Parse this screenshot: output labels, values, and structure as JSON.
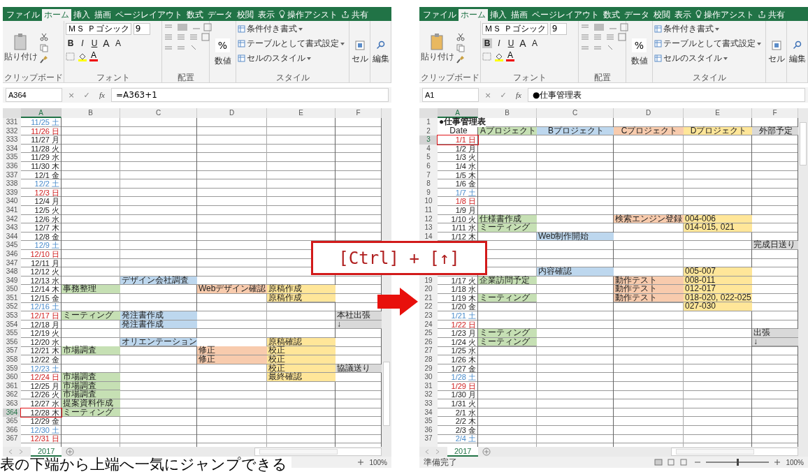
{
  "windows": [
    {
      "tabs": [
        {
          "label": "ファイル",
          "selected": false
        },
        {
          "label": "ホーム",
          "selected": true
        },
        {
          "label": "挿入",
          "selected": false
        },
        {
          "label": "描画",
          "selected": false
        },
        {
          "label": "ページレイアウト",
          "selected": false
        },
        {
          "label": "数式",
          "selected": false
        },
        {
          "label": "データ",
          "selected": false
        },
        {
          "label": "校閲",
          "selected": false
        },
        {
          "label": "表示",
          "selected": false
        }
      ],
      "tell_me": "操作アシスト",
      "share": "共有",
      "clipboard": {
        "paste": "貼り付け",
        "group": "クリップボード"
      },
      "font": {
        "name": "ＭＳ Ｐゴシック",
        "size": "9",
        "buttons": [
          {
            "label": "B",
            "selected": false
          },
          {
            "label": "I",
            "selected": false
          },
          {
            "label": "U",
            "selected": false
          }
        ],
        "grow": "A",
        "shrink": "A",
        "color_letter": "A",
        "group": "フォント"
      },
      "alignment": {
        "group": "配置"
      },
      "number": {
        "symbol": "%",
        "label": "数値"
      },
      "styles": {
        "items": [
          "条件付き書式",
          "テーブルとして書式設定",
          "セルのスタイル"
        ],
        "group": "スタイル"
      },
      "cells_label": "セル",
      "editing_label": "編集",
      "name_box": "A364",
      "formula_buttons": [
        "×",
        "✓",
        "fx"
      ],
      "formula": "=A363+1",
      "columns": [
        {
          "label": "A",
          "selected": true
        },
        {
          "label": "B",
          "selected": false
        },
        {
          "label": "C",
          "selected": false
        },
        {
          "label": "D",
          "selected": false
        },
        {
          "label": "E",
          "selected": false
        },
        {
          "label": "F",
          "selected": false
        }
      ],
      "rows": [
        {
          "kind": "sat",
          "num": "331",
          "date": "11/25 土",
          "selected": false
        },
        {
          "kind": "sun",
          "num": "332",
          "date": "11/26 日",
          "selected": false
        },
        {
          "kind": "weekday",
          "num": "333",
          "date": "11/27 月",
          "selected": false
        },
        {
          "kind": "weekday",
          "num": "334",
          "date": "11/28 火",
          "selected": false
        },
        {
          "kind": "weekday",
          "num": "335",
          "date": "11/29 水",
          "selected": false
        },
        {
          "kind": "weekday",
          "num": "336",
          "date": "11/30 木",
          "selected": false
        },
        {
          "kind": "weekday",
          "num": "337",
          "date": "12/1 金",
          "selected": false
        },
        {
          "kind": "sat",
          "num": "338",
          "date": "12/2 土",
          "selected": false
        },
        {
          "kind": "sun",
          "num": "339",
          "date": "12/3 日",
          "selected": false
        },
        {
          "kind": "weekday",
          "num": "340",
          "date": "12/4 月",
          "selected": false
        },
        {
          "kind": "weekday",
          "num": "341",
          "date": "12/5 火",
          "selected": false
        },
        {
          "kind": "weekday",
          "num": "342",
          "date": "12/6 水",
          "selected": false
        },
        {
          "kind": "weekday",
          "num": "343",
          "date": "12/7 木",
          "selected": false
        },
        {
          "kind": "weekday",
          "num": "344",
          "date": "12/8 金",
          "selected": false
        },
        {
          "kind": "sat",
          "num": "345",
          "date": "12/9 土",
          "selected": false
        },
        {
          "kind": "sun",
          "num": "346",
          "date": "12/10 日",
          "selected": false
        },
        {
          "kind": "weekday",
          "num": "347",
          "date": "12/11 月",
          "selected": false
        },
        {
          "kind": "weekday",
          "num": "348",
          "date": "12/12 火",
          "selected": false
        },
        {
          "kind": "weekday",
          "num": "349",
          "date": "12/13 水",
          "selected": false,
          "c": {
            "text": "デザイン会社調査",
            "color": "#bdd7ee"
          }
        },
        {
          "kind": "weekday",
          "num": "350",
          "date": "12/14 木",
          "selected": false,
          "b": {
            "text": "事務整理",
            "color": "#c6e0b4"
          },
          "d": {
            "text": "Webデザイン確認",
            "color": "#f8cbad"
          },
          "e": {
            "text": "原稿作成",
            "color": "#ffe699"
          }
        },
        {
          "kind": "weekday",
          "num": "351",
          "date": "12/15 金",
          "selected": false,
          "e": {
            "text": "原稿作成",
            "color": "#ffe699"
          }
        },
        {
          "kind": "sat",
          "num": "352",
          "date": "12/16 土",
          "selected": false
        },
        {
          "kind": "sun",
          "num": "353",
          "date": "12/17 日",
          "selected": false,
          "b": {
            "text": "ミーティング",
            "color": "#c6e0b4"
          },
          "c": {
            "text": "発注書作成",
            "color": "#bdd7ee"
          },
          "f": {
            "text": "本社出張",
            "color": "#d9d9d9"
          }
        },
        {
          "kind": "weekday",
          "num": "354",
          "date": "12/18 月",
          "selected": false,
          "c": {
            "text": "発注書作成",
            "color": "#bdd7ee"
          },
          "f": {
            "text": "↓",
            "color": "#d9d9d9"
          }
        },
        {
          "kind": "weekday",
          "num": "355",
          "date": "12/19 火",
          "selected": false
        },
        {
          "kind": "weekday",
          "num": "356",
          "date": "12/20 水",
          "selected": false,
          "c": {
            "text": "オリエンテーション",
            "color": "#bdd7ee"
          },
          "e": {
            "text": "原稿確認",
            "color": "#ffe699"
          }
        },
        {
          "kind": "weekday",
          "num": "357",
          "date": "12/21 木",
          "selected": false,
          "b": {
            "text": "市場調査",
            "color": "#c6e0b4"
          },
          "d": {
            "text": "修正",
            "color": "#f8cbad"
          },
          "e": {
            "text": "校正",
            "color": "#ffe699"
          }
        },
        {
          "kind": "weekday",
          "num": "358",
          "date": "12/22 金",
          "selected": false,
          "d": {
            "text": "修正",
            "color": "#f8cbad"
          },
          "e": {
            "text": "校正",
            "color": "#ffe699"
          }
        },
        {
          "kind": "sat",
          "num": "359",
          "date": "12/23 土",
          "selected": false,
          "e": {
            "text": "校正",
            "color": "#ffe699"
          },
          "f": {
            "text": "協議送り",
            "color": "#d9d9d9"
          }
        },
        {
          "kind": "sun",
          "num": "360",
          "date": "12/24 日",
          "selected": false,
          "b": {
            "text": "市場調査",
            "color": "#c6e0b4"
          },
          "e": {
            "text": "最終確認",
            "color": "#ffe699"
          }
        },
        {
          "kind": "weekday",
          "num": "361",
          "date": "12/25 月",
          "selected": false,
          "b": {
            "text": "市場調査",
            "color": "#c6e0b4"
          }
        },
        {
          "kind": "weekday",
          "num": "362",
          "date": "12/26 火",
          "selected": false,
          "b": {
            "text": "市場調査",
            "color": "#c6e0b4"
          }
        },
        {
          "kind": "weekday",
          "num": "363",
          "date": "12/27 水",
          "selected": false,
          "b": {
            "text": "提案資料作成",
            "color": "#c6e0b4"
          }
        },
        {
          "kind": "weekday",
          "num": "364",
          "date": "12/28 木",
          "selected": true,
          "b": {
            "text": "ミーティング",
            "color": "#c6e0b4"
          }
        },
        {
          "kind": "weekday",
          "num": "365",
          "date": "12/29 金",
          "selected": false
        },
        {
          "kind": "sat",
          "num": "366",
          "date": "12/30 土",
          "selected": false
        },
        {
          "kind": "sun",
          "num": "367",
          "date": "12/31 日",
          "selected": false
        }
      ],
      "sheet_tab": "2017",
      "zoom": "100%"
    },
    {
      "tabs": [
        {
          "label": "ファイル",
          "selected": false
        },
        {
          "label": "ホーム",
          "selected": true
        },
        {
          "label": "挿入",
          "selected": false
        },
        {
          "label": "描画",
          "selected": false
        },
        {
          "label": "ページレイアウト",
          "selected": false
        },
        {
          "label": "数式",
          "selected": false
        },
        {
          "label": "データ",
          "selected": false
        },
        {
          "label": "校閲",
          "selected": false
        },
        {
          "label": "表示",
          "selected": false
        }
      ],
      "tell_me": "操作アシスト",
      "share": "共有",
      "clipboard": {
        "paste": "貼り付け",
        "group": "クリップボード"
      },
      "font": {
        "name": "ＭＳ Ｐゴシック",
        "size": "9",
        "buttons": [
          {
            "label": "B",
            "selected": true
          },
          {
            "label": "I",
            "selected": false
          },
          {
            "label": "U",
            "selected": false
          }
        ],
        "grow": "A",
        "shrink": "A",
        "color_letter": "A",
        "group": "フォント"
      },
      "alignment": {
        "group": "配置"
      },
      "number": {
        "symbol": "%",
        "label": "数値"
      },
      "styles": {
        "items": [
          "条件付き書式",
          "テーブルとして書式設定",
          "セルのスタイル"
        ],
        "group": "スタイル"
      },
      "cells_label": "セル",
      "editing_label": "編集",
      "name_box": "A1",
      "formula_buttons": [
        "×",
        "✓",
        "fx"
      ],
      "formula": "●仕事管理表",
      "columns": [
        {
          "label": "A",
          "selected": true
        },
        {
          "label": "B",
          "selected": false
        },
        {
          "label": "C",
          "selected": false
        },
        {
          "label": "D",
          "selected": false
        },
        {
          "label": "E",
          "selected": false
        },
        {
          "label": "F",
          "selected": false
        }
      ],
      "rows": [
        {
          "kind": "title",
          "num": "1",
          "title": "●仕事管理表",
          "selected": false
        },
        {
          "kind": "header",
          "num": "2",
          "selected": false,
          "a": {
            "text": "Date"
          },
          "b": {
            "text": "Aプロジェクト",
            "color": "#c6e0b4"
          },
          "c": {
            "text": "Bプロジェクト",
            "color": "#bdd7ee"
          },
          "d": {
            "text": "Cプロジェクト",
            "color": "#f8cbad"
          },
          "e": {
            "text": "Dプロジェクト",
            "color": "#ffe699"
          },
          "f": {
            "text": "外部予定",
            "color": "#d9d9d9"
          }
        },
        {
          "kind": "sun",
          "num": "3",
          "date": "1/1 日",
          "selected": true
        },
        {
          "kind": "weekday",
          "num": "4",
          "date": "1/2 月",
          "selected": false
        },
        {
          "kind": "weekday",
          "num": "5",
          "date": "1/3 火",
          "selected": false
        },
        {
          "kind": "weekday",
          "num": "6",
          "date": "1/4 水",
          "selected": false
        },
        {
          "kind": "weekday",
          "num": "7",
          "date": "1/5 木",
          "selected": false
        },
        {
          "kind": "weekday",
          "num": "8",
          "date": "1/6 金",
          "selected": false
        },
        {
          "kind": "sat",
          "num": "9",
          "date": "1/7 土",
          "selected": false
        },
        {
          "kind": "sun",
          "num": "10",
          "date": "1/8 日",
          "selected": false
        },
        {
          "kind": "weekday",
          "num": "11",
          "date": "1/9 月",
          "selected": false
        },
        {
          "kind": "weekday",
          "num": "12",
          "date": "1/10 火",
          "selected": false,
          "b": {
            "text": "仕様書作成",
            "color": "#c6e0b4"
          },
          "d": {
            "text": "検索エンジン登録",
            "color": "#f8cbad"
          },
          "e": {
            "text": "004-006",
            "color": "#ffe699"
          }
        },
        {
          "kind": "weekday",
          "num": "13",
          "date": "1/11 水",
          "selected": false,
          "b": {
            "text": "ミーティング",
            "color": "#c6e0b4"
          },
          "e": {
            "text": "014-015, 021",
            "color": "#ffe699"
          }
        },
        {
          "kind": "weekday",
          "num": "14",
          "date": "1/12 木",
          "selected": false,
          "c": {
            "text": "Web制作開始",
            "color": "#bdd7ee"
          }
        },
        {
          "kind": "covered",
          "f": {
            "text": "完成日送り",
            "color": "#d9d9d9"
          }
        },
        {
          "kind": "covered"
        },
        {
          "kind": "covered"
        },
        {
          "kind": "covered",
          "c": {
            "text": "内容確認",
            "color": "#bdd7ee"
          },
          "e": {
            "text": "005-007",
            "color": "#ffe699"
          }
        },
        {
          "kind": "weekday",
          "num": "19",
          "date": "1/17 火",
          "selected": false,
          "b": {
            "text": "企業訪問予定",
            "color": "#c6e0b4"
          },
          "d": {
            "text": "動作テスト",
            "color": "#f8cbad"
          },
          "e": {
            "text": "008-011",
            "color": "#ffe699"
          }
        },
        {
          "kind": "weekday",
          "num": "20",
          "date": "1/18 水",
          "selected": false,
          "d": {
            "text": "動作テスト",
            "color": "#f8cbad"
          },
          "e": {
            "text": "012-017",
            "color": "#ffe699"
          }
        },
        {
          "kind": "weekday",
          "num": "21",
          "date": "1/19 木",
          "selected": false,
          "b": {
            "text": "ミーティング",
            "color": "#c6e0b4"
          },
          "d": {
            "text": "動作テスト",
            "color": "#f8cbad"
          },
          "e": {
            "text": "018-020, 022-025",
            "color": "#ffe699"
          }
        },
        {
          "kind": "weekday",
          "num": "22",
          "date": "1/20 金",
          "selected": false,
          "e": {
            "text": "027-030",
            "color": "#ffe699"
          }
        },
        {
          "kind": "sat",
          "num": "23",
          "date": "1/21 土",
          "selected": false
        },
        {
          "kind": "sun",
          "num": "24",
          "date": "1/22 日",
          "selected": false
        },
        {
          "kind": "weekday",
          "num": "25",
          "date": "1/23 月",
          "selected": false,
          "b": {
            "text": "ミーティング",
            "color": "#c6e0b4"
          },
          "f": {
            "text": "出張",
            "color": "#d9d9d9"
          }
        },
        {
          "kind": "weekday",
          "num": "26",
          "date": "1/24 火",
          "selected": false,
          "b": {
            "text": "ミーティング",
            "color": "#c6e0b4"
          },
          "f": {
            "text": "↓",
            "color": "#d9d9d9"
          }
        },
        {
          "kind": "weekday",
          "num": "27",
          "date": "1/25 水",
          "selected": false
        },
        {
          "kind": "weekday",
          "num": "28",
          "date": "1/26 木",
          "selected": false
        },
        {
          "kind": "weekday",
          "num": "29",
          "date": "1/27 金",
          "selected": false
        },
        {
          "kind": "sat",
          "num": "30",
          "date": "1/28 土",
          "selected": false
        },
        {
          "kind": "sun",
          "num": "31",
          "date": "1/29 日",
          "selected": false
        },
        {
          "kind": "weekday",
          "num": "32",
          "date": "1/30 月",
          "selected": false
        },
        {
          "kind": "weekday",
          "num": "33",
          "date": "1/31 火",
          "selected": false
        },
        {
          "kind": "weekday",
          "num": "34",
          "date": "2/1 水",
          "selected": false
        },
        {
          "kind": "weekday",
          "num": "35",
          "date": "2/2 木",
          "selected": false
        },
        {
          "kind": "weekday",
          "num": "36",
          "date": "2/3 金",
          "selected": false
        },
        {
          "kind": "sat",
          "num": "37",
          "date": "2/4 土",
          "selected": false
        }
      ],
      "sheet_tab": "2017",
      "status": "準備完了",
      "zoom": "100%",
      "zoom_slider": {
        "level": 0.5
      }
    }
  ],
  "shortcut": "[Ctrl] + [↑]",
  "caption": "表の下端から上端へ一気にジャンプできる"
}
